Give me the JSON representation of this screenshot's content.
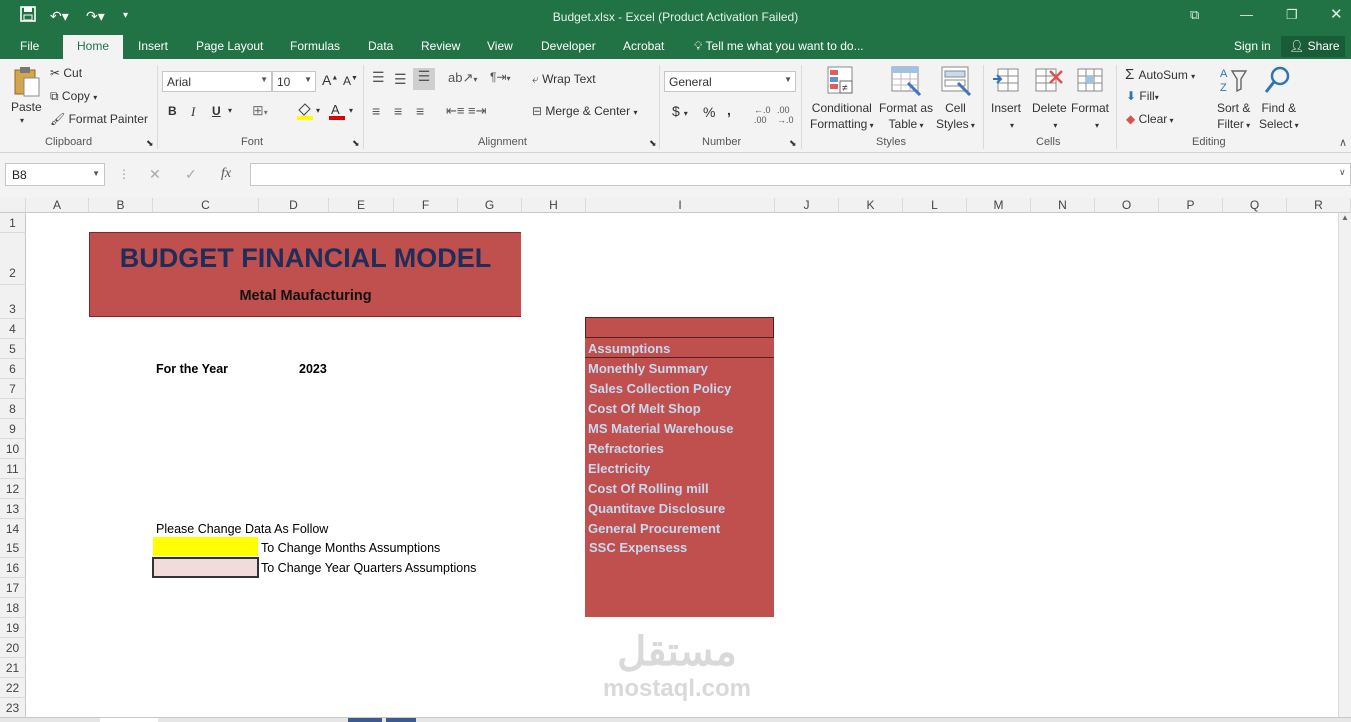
{
  "window": {
    "title": "Budget.xlsx - Excel (Product Activation Failed)"
  },
  "tabs": [
    "File",
    "Home",
    "Insert",
    "Page Layout",
    "Formulas",
    "Data",
    "Review",
    "View",
    "Developer",
    "Acrobat"
  ],
  "tell_me": "Tell me what you want to do...",
  "sign_in": "Sign in",
  "share": "Share",
  "ribbon": {
    "clipboard": {
      "paste": "Paste",
      "cut": "Cut",
      "copy": "Copy",
      "format_painter": "Format Painter",
      "label": "Clipboard"
    },
    "font": {
      "name": "Arial",
      "size": "10",
      "bold": "B",
      "italic": "I",
      "underline": "U",
      "label": "Font"
    },
    "alignment": {
      "wrap": "Wrap Text",
      "merge": "Merge & Center",
      "label": "Alignment"
    },
    "number": {
      "format": "General",
      "currency": "$",
      "percent": "%",
      "comma": ",",
      "label": "Number"
    },
    "styles": {
      "cond1": "Conditional",
      "cond2": "Formatting",
      "fmt1": "Format as",
      "fmt2": "Table",
      "cell1": "Cell",
      "cell2": "Styles",
      "label": "Styles"
    },
    "cells": {
      "insert": "Insert",
      "delete": "Delete",
      "format": "Format",
      "label": "Cells"
    },
    "editing": {
      "autosum": "AutoSum",
      "fill": "Fill",
      "clear": "Clear",
      "sort1": "Sort &",
      "sort2": "Filter",
      "find1": "Find &",
      "find2": "Select",
      "label": "Editing"
    }
  },
  "formula_bar": {
    "name_box": "B8",
    "fx": "fx",
    "value": ""
  },
  "columns": [
    "A",
    "B",
    "C",
    "D",
    "E",
    "F",
    "G",
    "H",
    "I",
    "J",
    "K",
    "L",
    "M",
    "N",
    "O",
    "P",
    "Q",
    "R"
  ],
  "rows": [
    "1",
    "2",
    "3",
    "4",
    "5",
    "6",
    "7",
    "8",
    "9",
    "10",
    "11",
    "12",
    "13",
    "14",
    "15",
    "16",
    "17",
    "18",
    "19",
    "20",
    "21",
    "22",
    "23"
  ],
  "sheet": {
    "banner_title": "BUDGET FINANCIAL MODEL",
    "banner_subtitle": "Metal Maufacturing",
    "year_label": "For the Year",
    "year_value": "2023",
    "instruction": "Please Change Data As Follow",
    "legend_months": "To Change Months Assumptions",
    "legend_quarters": "To Change Year Quarters Assumptions",
    "colors": {
      "banner": "#c0504d",
      "panel": "#c0504d",
      "link": "#c5d9f1",
      "yellow": "#ffff00",
      "pink": "#f2dcdb"
    }
  },
  "nav_links": [
    "Assumptions",
    "Monethly Summary",
    "Sales Collection Policy",
    "Cost Of Melt Shop",
    "MS Material Warehouse",
    "Refractories",
    "Electricity",
    "Cost Of Rolling mill",
    "Quantitave Disclosure",
    "General Procurement",
    "SSC Expensess"
  ],
  "watermark": {
    "arabic": "مستقل",
    "latin": "mostaql.com"
  }
}
